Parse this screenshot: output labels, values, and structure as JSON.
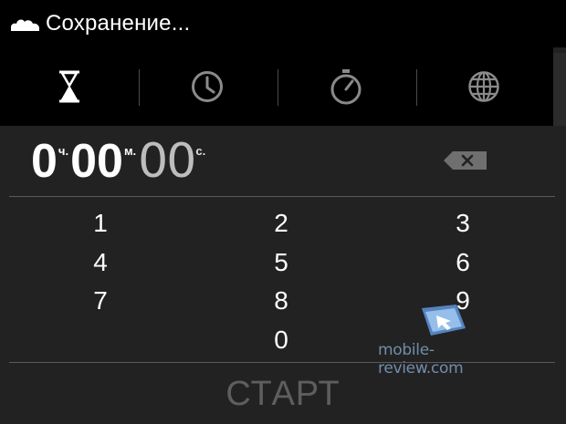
{
  "status": {
    "text": "Сохранение..."
  },
  "tabs": [
    {
      "icon": "hourglass-icon",
      "name": "timer",
      "active": true
    },
    {
      "icon": "clock-icon",
      "name": "alarm",
      "active": false
    },
    {
      "icon": "stopwatch-icon",
      "name": "stopwatch",
      "active": false
    },
    {
      "icon": "globe-icon",
      "name": "world-clock",
      "active": false
    }
  ],
  "timer": {
    "hours": "0",
    "hours_unit": "ч.",
    "minutes": "00",
    "minutes_unit": "м.",
    "seconds": "00",
    "seconds_unit": "с."
  },
  "keypad": {
    "k1": "1",
    "k2": "2",
    "k3": "3",
    "k4": "4",
    "k5": "5",
    "k6": "6",
    "k7": "7",
    "k8": "8",
    "k9": "9",
    "k0": "0"
  },
  "watermark": {
    "text": "mobile-review.com"
  },
  "start_button": {
    "label": "СТАРТ"
  },
  "colors": {
    "background": "#222222",
    "bar": "#000000",
    "disabled_text": "#5e5e5e"
  }
}
